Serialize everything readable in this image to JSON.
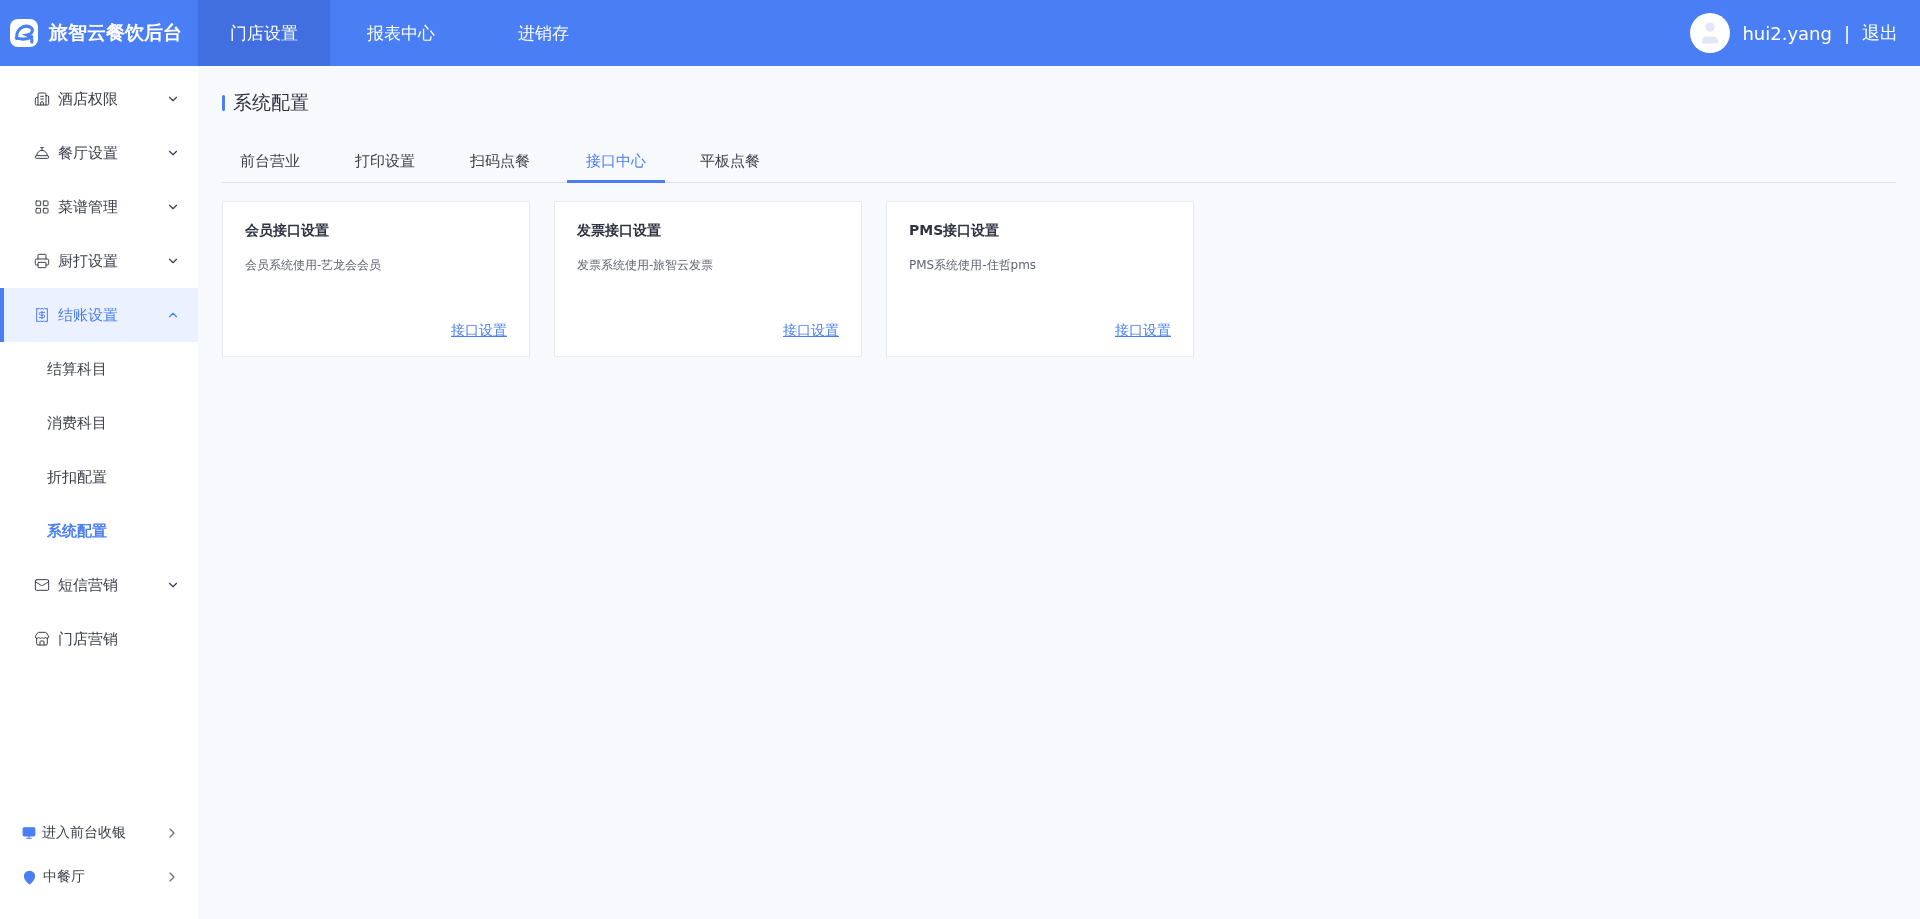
{
  "header": {
    "brand": "旅智云餐饮后台",
    "nav": [
      {
        "label": "门店设置",
        "selected": true
      },
      {
        "label": "报表中心",
        "selected": false
      },
      {
        "label": "进销存",
        "selected": false
      }
    ],
    "user": "hui2.yang",
    "separator": "|",
    "logout": "退出"
  },
  "sidebar": {
    "items": [
      {
        "label": "酒店权限",
        "selected": false,
        "expanded": false
      },
      {
        "label": "餐厅设置",
        "selected": false,
        "expanded": false
      },
      {
        "label": "菜谱管理",
        "selected": false,
        "expanded": false
      },
      {
        "label": "厨打设置",
        "selected": false,
        "expanded": false
      },
      {
        "label": "结账设置",
        "selected": true,
        "expanded": true,
        "children": [
          {
            "label": "结算科目",
            "selected": false
          },
          {
            "label": "消费科目",
            "selected": false
          },
          {
            "label": "折扣配置",
            "selected": false
          },
          {
            "label": "系统配置",
            "selected": true
          }
        ]
      },
      {
        "label": "短信营销",
        "selected": false,
        "expanded": false
      },
      {
        "label": "门店营销",
        "selected": false
      }
    ],
    "footer": [
      {
        "label": "进入前台收银"
      },
      {
        "label": "中餐厅"
      }
    ]
  },
  "page": {
    "title": "系统配置",
    "tabs": [
      {
        "label": "前台营业",
        "selected": false
      },
      {
        "label": "打印设置",
        "selected": false
      },
      {
        "label": "扫码点餐",
        "selected": false
      },
      {
        "label": "接口中心",
        "selected": true
      },
      {
        "label": "平板点餐",
        "selected": false
      }
    ],
    "cards": [
      {
        "title": "会员接口设置",
        "description": "会员系统使用-艺龙会会员",
        "link": "接口设置"
      },
      {
        "title": "发票接口设置",
        "description": "发票系统使用-旅智云发票",
        "link": "接口设置"
      },
      {
        "title": "PMS接口设置",
        "description": "PMS系统使用-住哲pms",
        "link": "接口设置"
      }
    ]
  }
}
